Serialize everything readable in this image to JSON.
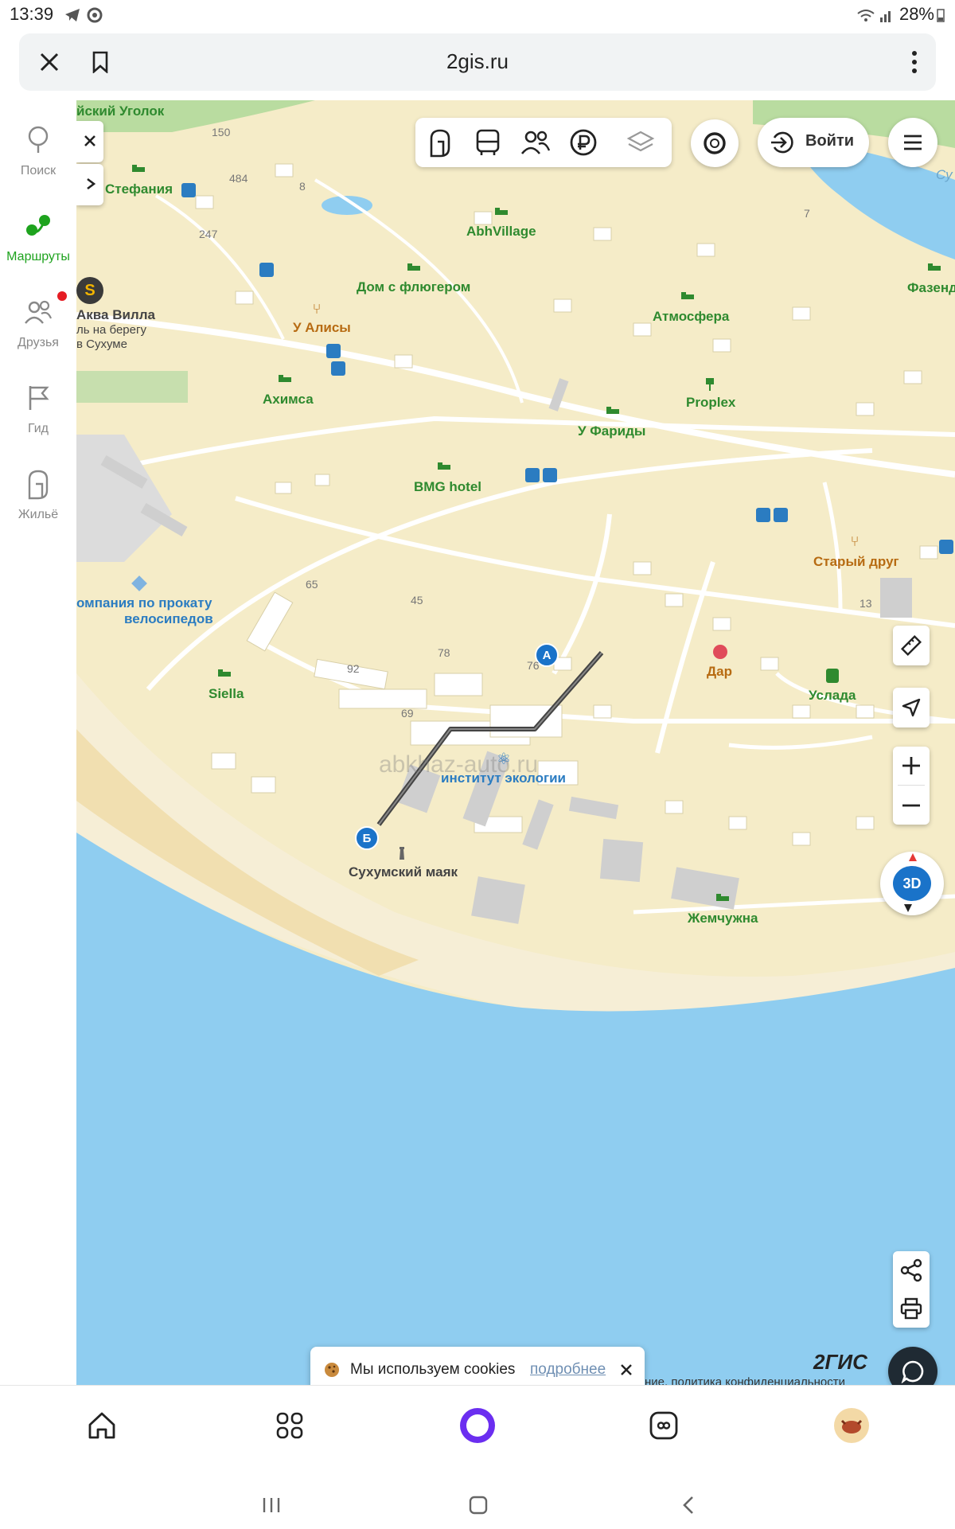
{
  "status_bar": {
    "time": "13:39",
    "battery": "28%"
  },
  "browser": {
    "url": "2gis.ru"
  },
  "sidebar": {
    "items": [
      {
        "label": "Поиск",
        "icon": "search-pin-icon"
      },
      {
        "label": "Маршруты",
        "icon": "routes-icon"
      },
      {
        "label": "Друзья",
        "icon": "friends-icon"
      },
      {
        "label": "Гид",
        "icon": "guide-flag-icon"
      },
      {
        "label": "Жильё",
        "icon": "housing-icon"
      }
    ],
    "active_color": "#1ea31e"
  },
  "map": {
    "login_label": "Войти",
    "badge_3d": "3D",
    "watermark": "abkhaz-auto.ru",
    "brand": "2ГИС",
    "footer_text": "ние, политика конфиденциальности",
    "route": {
      "start_marker": "А",
      "end_marker": "Б"
    },
    "labels": {
      "ugolok": "йский Уголок",
      "stefania": "Стефания",
      "abhvillage": "AbhVillage",
      "dom_flugerom": "Дом с флюгером",
      "atmosfera": "Атмосфера",
      "fazenda": "Фазенд",
      "aqua_villa": "Аква Вилла",
      "aqua_sub1": "ль на берегу",
      "aqua_sub2": "в Сухуме",
      "u_alisy": "У Алисы",
      "ahimsa": "Ахимса",
      "proplex": "Proplex",
      "u_faridy": "У Фариды",
      "bmg": "BMG hotel",
      "stary_drug": "Старый друг",
      "bike_1": "омпания по прокату",
      "bike_2": "велосипедов",
      "siella": "Siella",
      "dar": "Дар",
      "uslada": "Услада",
      "institut": "институт экологии",
      "mayak": "Сухумский маяк",
      "zhemchuzhina": "Жемчужна",
      "sukhum": "Су"
    },
    "house_numbers": {
      "n150": "150",
      "n484": "484",
      "n8": "8",
      "n247": "247",
      "n7": "7",
      "n65": "65",
      "n45": "45",
      "n78": "78",
      "n76": "76",
      "n92": "92",
      "n69": "69",
      "n13": "13"
    }
  },
  "cookie_banner": {
    "text": "Мы используем cookies",
    "link": "подробнее"
  },
  "colors": {
    "water": "#8fcdf0",
    "land": "#f5ecc8",
    "sand": "#f6eed6",
    "route": "#444444",
    "marker": "#1a73c9",
    "brand_purple": "#6b2ef0"
  }
}
